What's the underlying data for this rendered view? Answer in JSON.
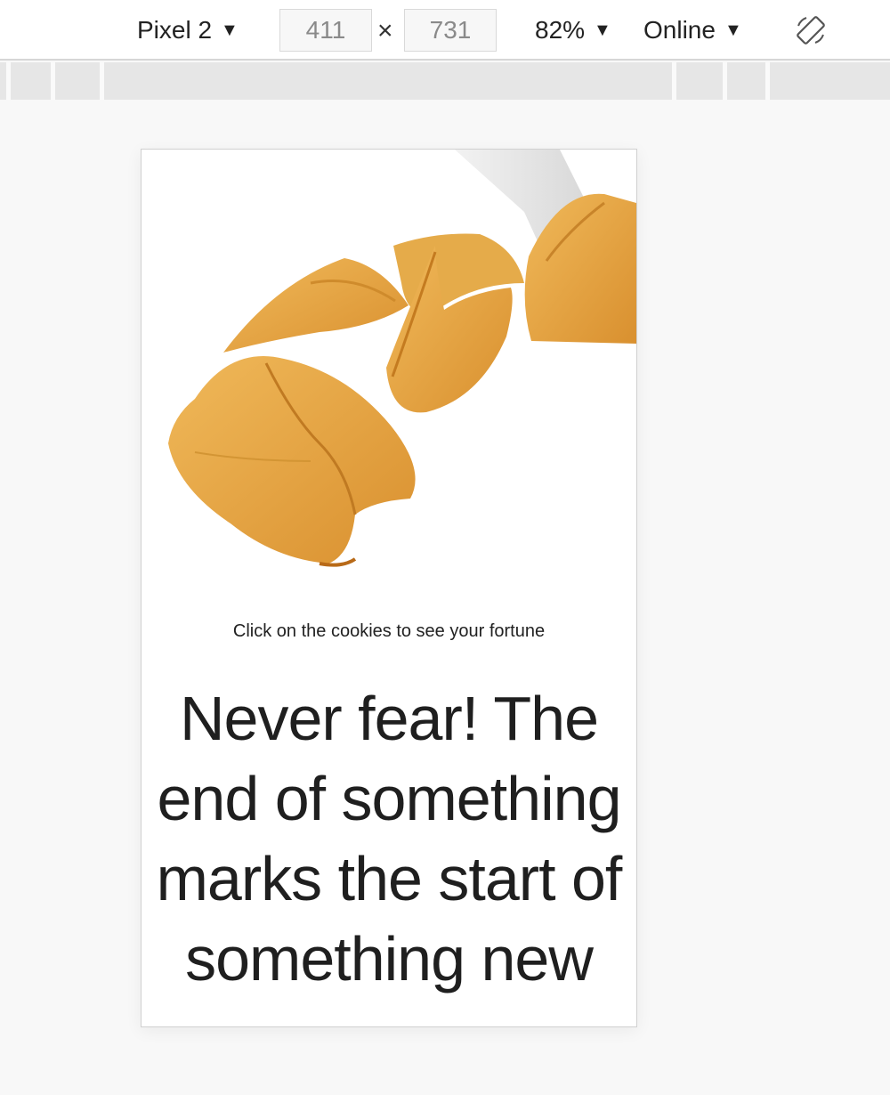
{
  "toolbar": {
    "device": "Pixel 2",
    "width": "411",
    "height": "731",
    "times": "×",
    "zoom": "82%",
    "network": "Online",
    "caret": "▼",
    "rotate_icon": "rotate-device-icon"
  },
  "page": {
    "hint": "Click on the cookies to see your fortune",
    "fortune": "Never fear! The end of something marks the start of something new",
    "image_icon": "fortune-cookies-image"
  },
  "colors": {
    "cookie": "#e3a640",
    "cookie_dark": "#c97f22",
    "paper": "#ececec",
    "text": "#1f1f1f"
  }
}
